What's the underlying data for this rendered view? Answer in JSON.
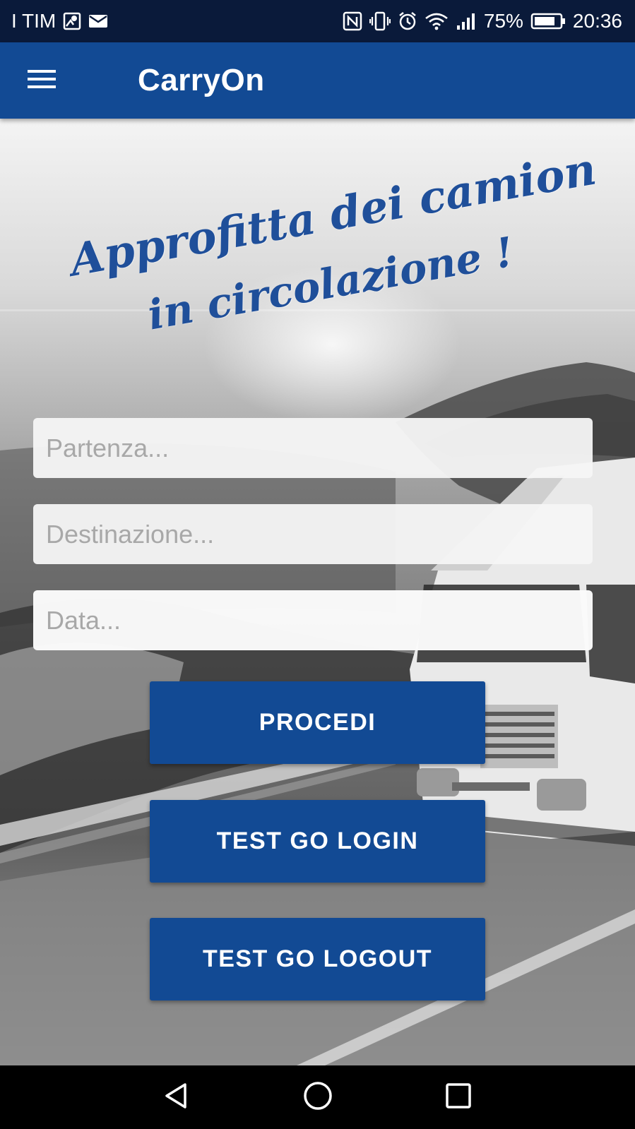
{
  "status_bar": {
    "carrier": "I TIM",
    "battery_percent": "75%",
    "time": "20:36",
    "icons": [
      "location-icon",
      "mail-icon",
      "nfc-icon",
      "vibrate-icon",
      "alarm-icon",
      "wifi-icon",
      "signal-icon",
      "battery-icon"
    ]
  },
  "app_bar": {
    "title": "CarryOn",
    "menu_icon": "hamburger-menu-icon",
    "color": "#124a94"
  },
  "hero": {
    "slogan_line_1": "Approfitta dei camion",
    "slogan_line_2": "in circolazione !",
    "slogan_color": "#1f4f9a"
  },
  "form": {
    "partenza_placeholder": "Partenza...",
    "destinazione_placeholder": "Destinazione...",
    "data_placeholder": "Data..."
  },
  "buttons": {
    "procedi": "PROCEDI",
    "test_login": "TEST GO LOGIN",
    "test_logout": "TEST GO LOGOUT",
    "color": "#124a94"
  },
  "nav_bar": {
    "icons": [
      "back-icon",
      "home-icon",
      "recents-icon"
    ]
  }
}
